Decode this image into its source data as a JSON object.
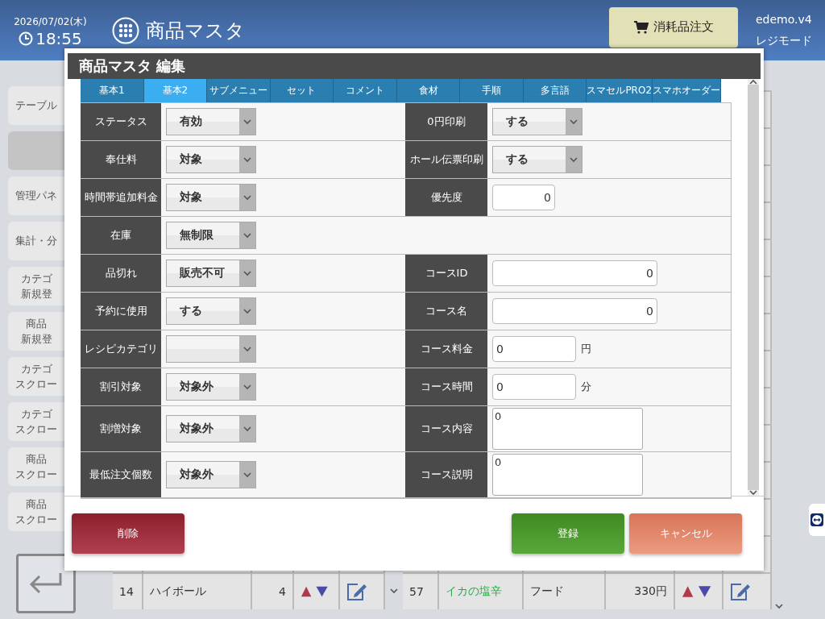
{
  "header": {
    "date": "2026/07/02(木)",
    "time": "18:55",
    "title": "商品マスタ",
    "order_button": "消耗品注文",
    "user": "edemo.v4",
    "mode": "レジモード"
  },
  "sidebar": {
    "items": [
      {
        "label": "テーブル",
        "selected": false
      },
      {
        "selected": true
      },
      {
        "label": "管理パネ",
        "selected": false
      },
      {
        "label": "集計・分",
        "selected": false
      },
      {
        "lines": [
          "カテゴ",
          "新規登"
        ],
        "selected": false
      },
      {
        "lines": [
          "商品",
          "新規登"
        ],
        "selected": false
      },
      {
        "lines": [
          "カテゴ",
          "スクロー"
        ],
        "selected": false
      },
      {
        "lines": [
          "カテゴ",
          "スクロー"
        ],
        "selected": false
      },
      {
        "lines": [
          "商品",
          "スクロー"
        ],
        "selected": false
      },
      {
        "lines": [
          "商品",
          "スクロー"
        ],
        "selected": false
      }
    ]
  },
  "list_left": {
    "last_row": {
      "no": "14",
      "name": "ハイボール",
      "qty": "4"
    }
  },
  "list_right": {
    "last_row": {
      "no": "57",
      "name": "イカの塩辛",
      "category": "フード",
      "price": "330円"
    }
  },
  "dialog": {
    "title": "商品マスタ 編集",
    "tabs": [
      {
        "label": "基本1",
        "selected": false
      },
      {
        "label": "基本2",
        "selected": true
      },
      {
        "label": "サブメニュー",
        "selected": false
      },
      {
        "label": "セット",
        "selected": false
      },
      {
        "label": "コメント",
        "selected": false
      },
      {
        "label": "食材",
        "selected": false
      },
      {
        "label": "手順",
        "selected": false
      },
      {
        "label": "多言語",
        "selected": false
      },
      {
        "label": "スマセルPRO2",
        "selected": false
      },
      {
        "label": "スマホオーダー",
        "selected": false
      }
    ],
    "rows": [
      {
        "left": {
          "label": "ステータス",
          "kind": "select",
          "value": "有効"
        },
        "right": {
          "label": "0円印刷",
          "kind": "select",
          "value": "する"
        }
      },
      {
        "left": {
          "label": "奉仕料",
          "kind": "select",
          "value": "対象"
        },
        "right": {
          "label": "ホール伝票印刷",
          "kind": "select",
          "value": "する"
        }
      },
      {
        "left": {
          "label": "時間帯追加料金",
          "kind": "select",
          "value": "対象"
        },
        "right": {
          "label": "優先度",
          "kind": "number",
          "value": "0"
        }
      },
      {
        "left": {
          "label": "在庫",
          "kind": "select",
          "value": "無制限"
        }
      },
      {
        "left": {
          "label": "品切れ",
          "kind": "select",
          "value": "販売不可"
        },
        "right": {
          "label": "コースID",
          "kind": "wide",
          "value": "0"
        }
      },
      {
        "left": {
          "label": "予約に使用",
          "kind": "select",
          "value": "する"
        },
        "right": {
          "label": "コース名",
          "kind": "wide",
          "value": "0"
        }
      },
      {
        "left": {
          "label": "レシピカテゴリ",
          "kind": "select"
        },
        "right": {
          "label": "コース料金",
          "kind": "text",
          "value": "0",
          "unit": "円"
        }
      },
      {
        "left": {
          "label": "割引対象",
          "kind": "select",
          "value": "対象外"
        },
        "right": {
          "label": "コース時間",
          "kind": "text",
          "value": "0",
          "unit": "分"
        }
      },
      {
        "left": {
          "label": "割増対象",
          "kind": "select",
          "value": "対象外"
        },
        "right": {
          "label": "コース内容",
          "kind": "textarea",
          "value": "0"
        }
      },
      {
        "left": {
          "label": "最低注文個数",
          "kind": "select",
          "value": "対象外"
        },
        "right": {
          "label": "コース説明",
          "kind": "textarea",
          "value": "0"
        }
      }
    ],
    "delete_button": "削除",
    "save_button": "登録",
    "cancel_button": "キャンセル"
  }
}
